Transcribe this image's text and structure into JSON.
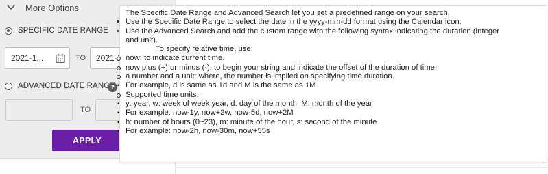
{
  "more_options": {
    "label": "More Options"
  },
  "specific_range": {
    "label": "SPECIFIC DATE RANGE",
    "start_value": "2021-1...",
    "to_label": "TO",
    "end_value": "2021-1"
  },
  "advanced_range": {
    "label": "ADVANCED DATE RANGE",
    "help_glyph": "?",
    "to_label": "TO"
  },
  "apply_button": {
    "label": "APPLY"
  },
  "tooltip": {
    "intro": "The Specific Date Range and Advanced Search let you set a predefined range on your search.",
    "bullet1": "Use the Specific Date Range to select the date in the yyyy-mm-dd format using the Calendar icon.",
    "bullet2_line1": "Use the Advanced Search and add the custom range with the following syntax indicating the duration (integer",
    "bullet2_line2": "and unit).",
    "relative_title": "To specify relative time, use:",
    "relative_items": [
      "now: to indicate current time.",
      "now plus (+) or minus (-): to begin your string and indicate the offset of the duration of time.",
      "a number and a unit: where, the number is implied on specifying time duration."
    ],
    "number_example": "For example, d is same as 1d and M is the same as 1M",
    "supported_title": "Supported time units:",
    "unit_group1": "y: year, w: week of week year, d: day of the month, M: month of the year",
    "unit_example1": "For example: now-1y, now+2w, now-5d, now+2M",
    "unit_group2": "h: number of hours (0~23), m: minute of the hour, s: second of the minute",
    "unit_example2": "For example: now-2h, now-30m, now+55s"
  },
  "colors": {
    "accent": "#6a1ea7",
    "panel_bg": "#ededed"
  }
}
